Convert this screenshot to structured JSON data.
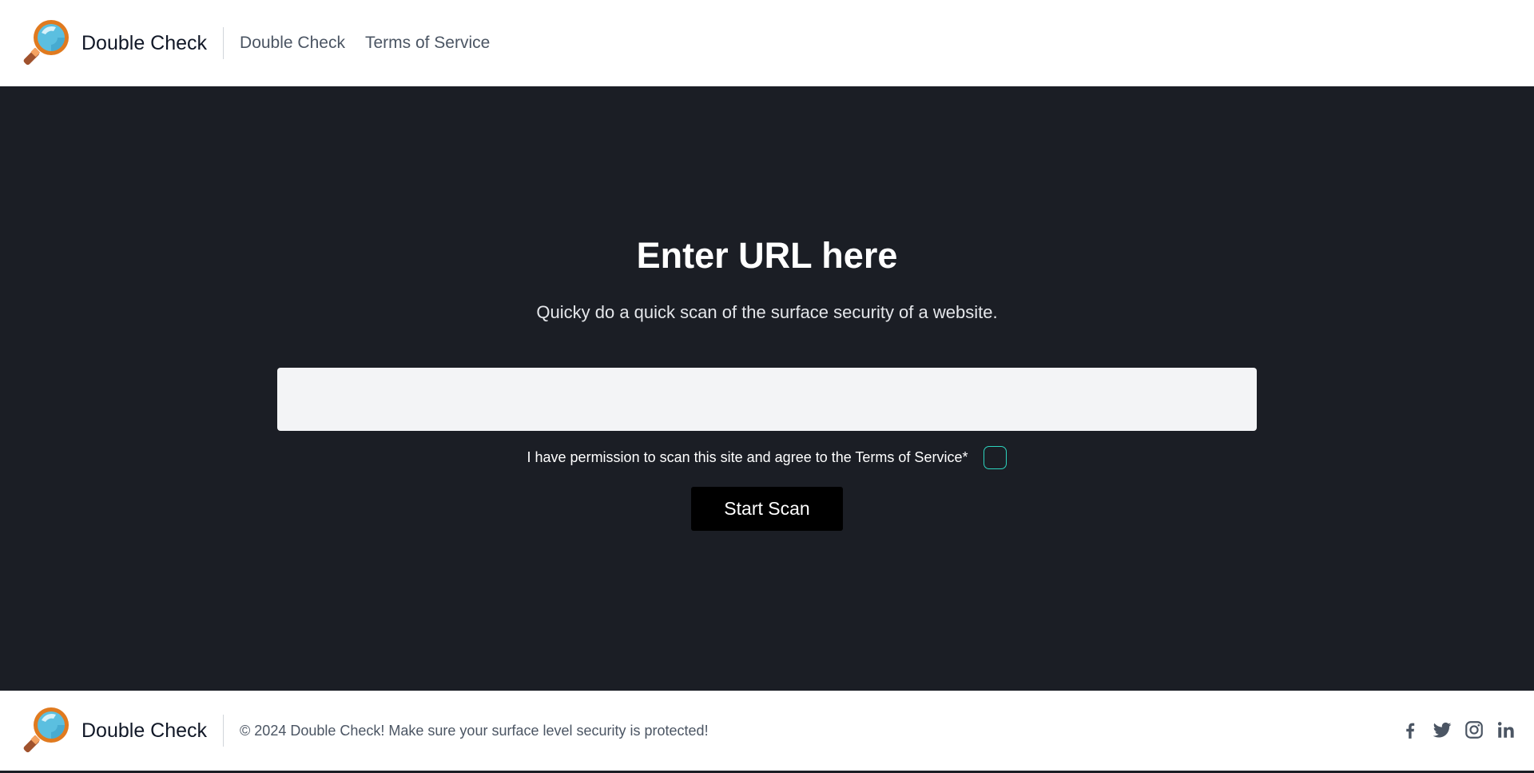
{
  "header": {
    "brand_name": "Double Check",
    "nav": [
      {
        "label": "Double Check"
      },
      {
        "label": "Terms of Service"
      }
    ]
  },
  "main": {
    "title": "Enter URL here",
    "subtitle": "Quicky do a quick scan of the surface security of a website.",
    "url_input": {
      "value": "",
      "placeholder": ""
    },
    "consent_label": "I have permission to scan this site and agree to the Terms of Service*",
    "consent_checked": false,
    "scan_button": "Start Scan"
  },
  "footer": {
    "brand_name": "Double Check",
    "copyright": "© 2024 Double Check! Make sure your surface level security is protected!",
    "socials": [
      "facebook-icon",
      "twitter-icon",
      "instagram-icon",
      "linkedin-icon"
    ]
  },
  "colors": {
    "main_bg": "#1b1e25",
    "input_bg": "#f3f4f6",
    "button_bg": "#000000",
    "checkbox_border": "#2dd4bf",
    "muted_text": "#4b5563"
  }
}
